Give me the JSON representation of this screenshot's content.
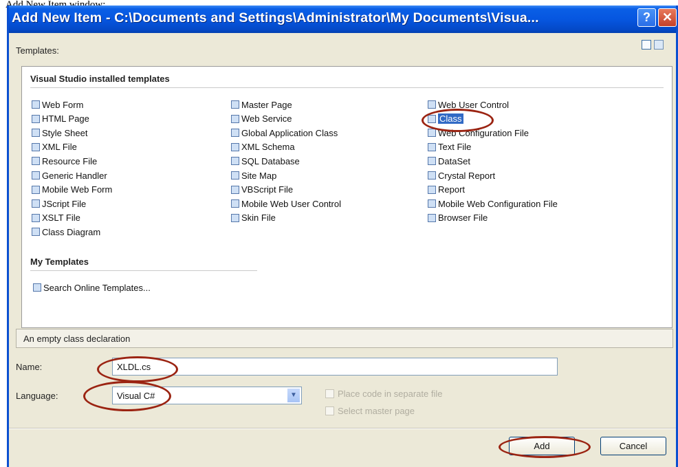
{
  "caption": "Add New Item window:",
  "window": {
    "title": "Add New Item - C:\\Documents and Settings\\Administrator\\My Documents\\Visua...",
    "help_label": "?",
    "close_label": "✕"
  },
  "templates_label": "Templates:",
  "groups": {
    "installed_header": "Visual Studio installed templates",
    "my_header": "My Templates"
  },
  "templates": {
    "col1": [
      "Web Form",
      "HTML Page",
      "Style Sheet",
      "XML File",
      "Resource File",
      "Generic Handler",
      "Mobile Web Form",
      "JScript File",
      "XSLT File",
      "Class Diagram"
    ],
    "col2": [
      "Master Page",
      "Web Service",
      "Global Application Class",
      "XML Schema",
      "SQL Database",
      "Site Map",
      "VBScript File",
      "Mobile Web User Control",
      "Skin File"
    ],
    "col3": [
      "Web User Control",
      "Class",
      "Web Configuration File",
      "Text File",
      "DataSet",
      "Crystal Report",
      "Report",
      "Mobile Web Configuration File",
      "Browser File"
    ],
    "my": [
      "Search Online Templates..."
    ],
    "selected": "Class"
  },
  "description": "An empty class declaration",
  "form": {
    "name_label": "Name:",
    "name_value": "XLDL.cs",
    "language_label": "Language:",
    "language_value": "Visual C#",
    "place_code_label": "Place code in separate file",
    "select_master_label": "Select master page"
  },
  "buttons": {
    "add": "Add",
    "cancel": "Cancel"
  },
  "colors": {
    "titlebar": "#0656e0",
    "annotation_oval": "#9b2412",
    "selection": "#316ac5"
  }
}
